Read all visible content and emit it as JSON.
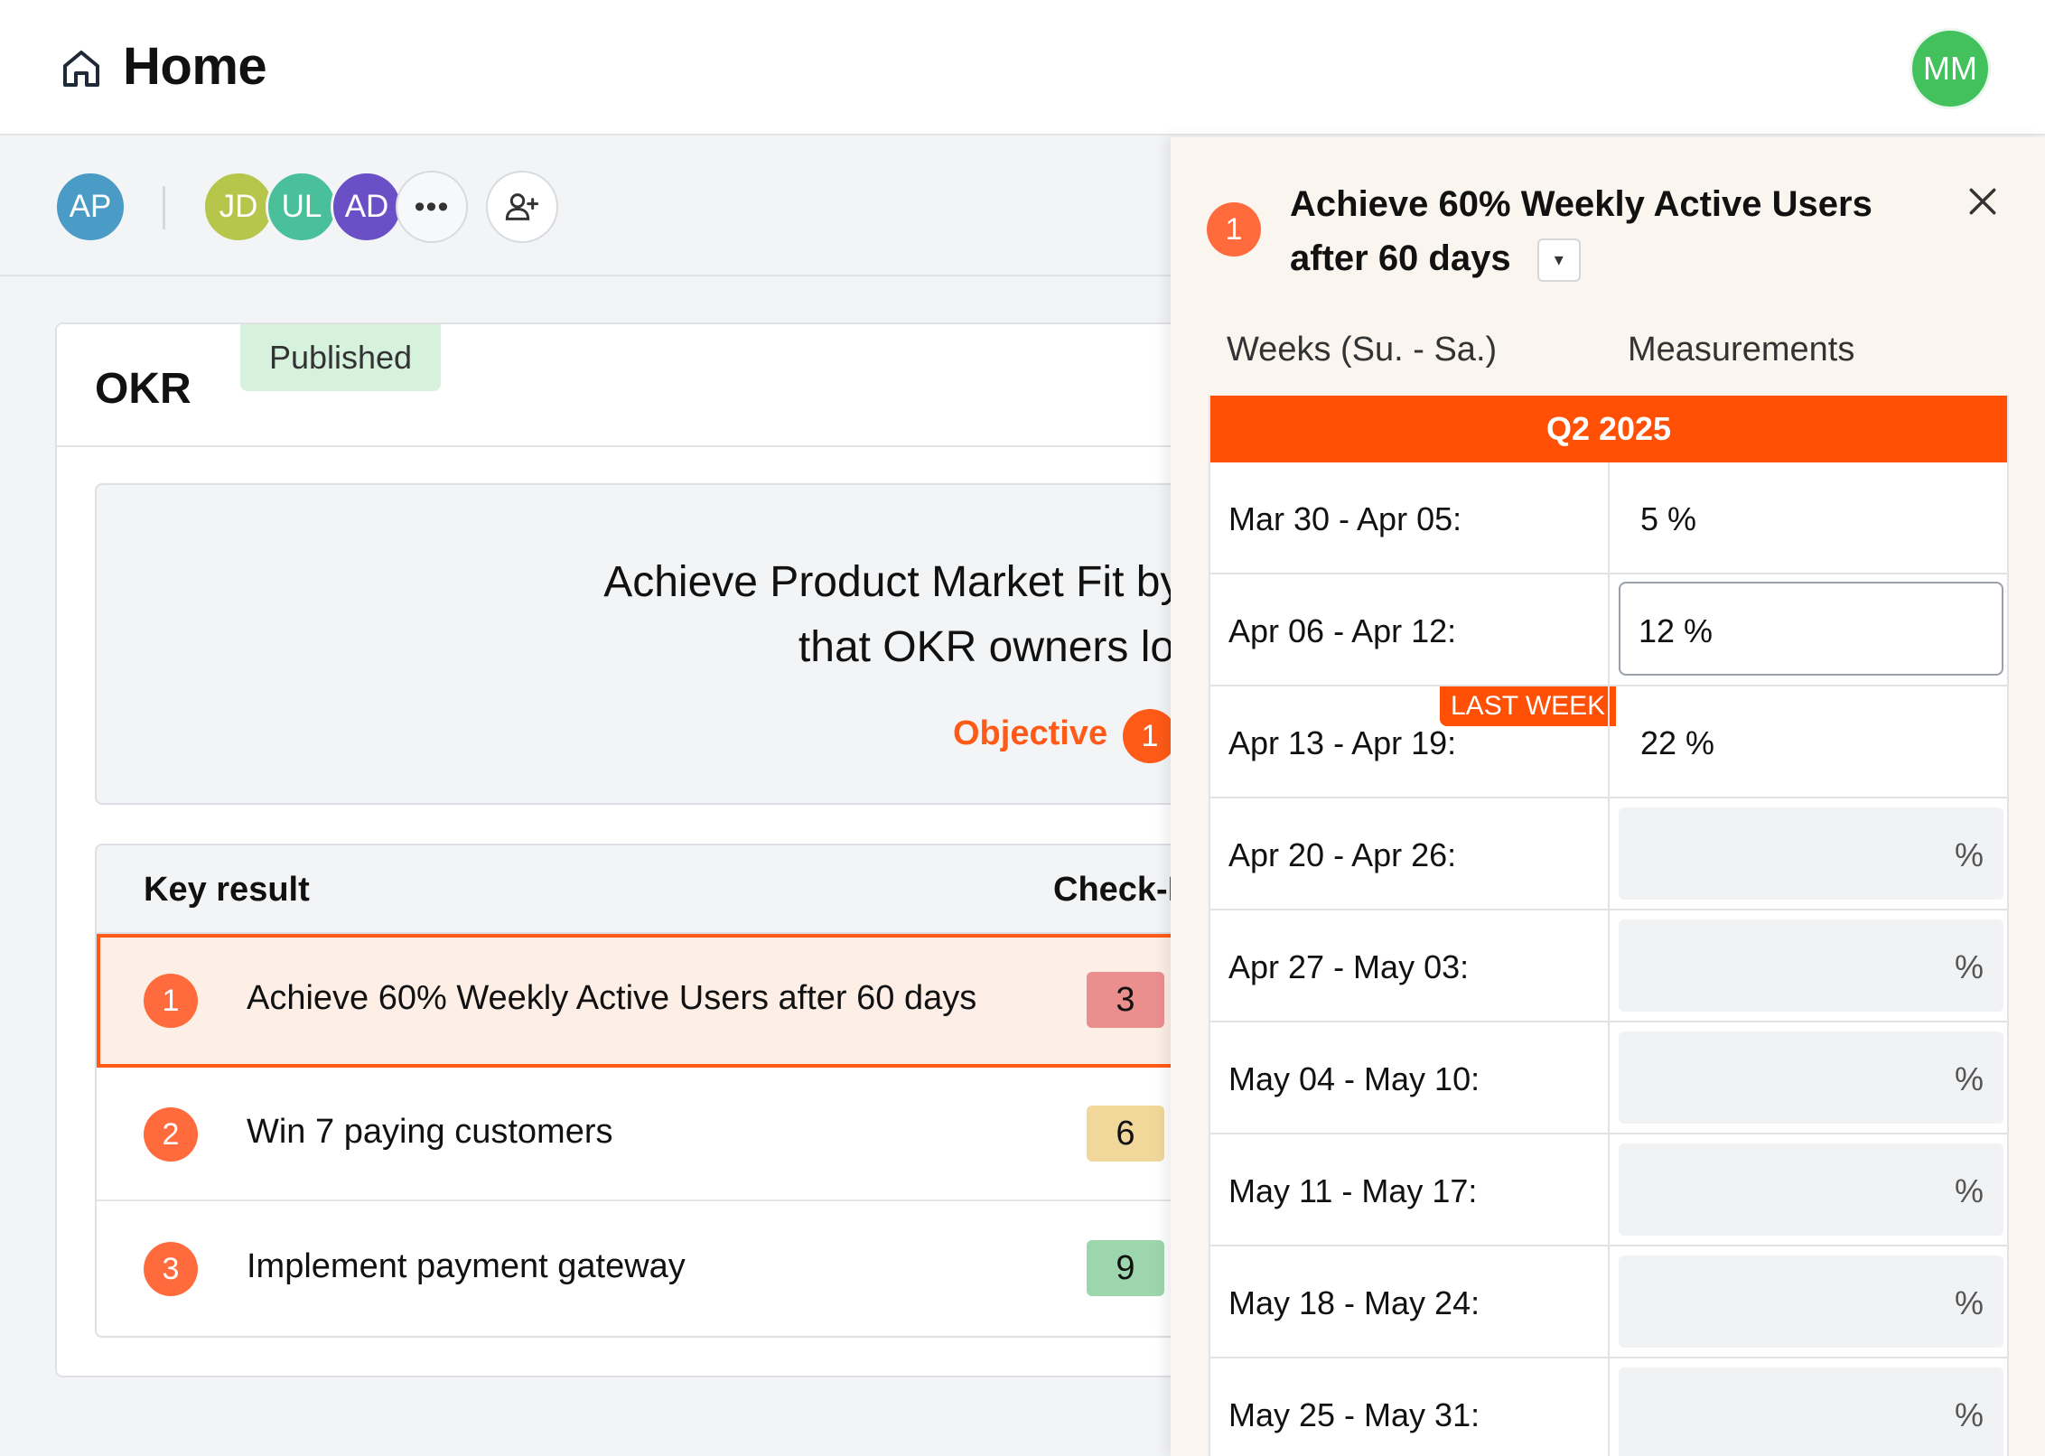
{
  "header": {
    "title": "Home",
    "user_initials": "MM"
  },
  "team": {
    "owner": {
      "initials": "AP",
      "color": "#4a9cc6"
    },
    "members": [
      {
        "initials": "JD",
        "color": "#b5c64a"
      },
      {
        "initials": "UL",
        "color": "#49bf9a"
      },
      {
        "initials": "AD",
        "color": "#6a4fc6"
      }
    ],
    "more_label": "•••"
  },
  "okr": {
    "title": "OKR",
    "status": "Published",
    "objective_text": "Achieve Product Market Fit by c\nthat OKR owners lo",
    "objective_label": "Objective",
    "objective_number": "1",
    "table_headers": {
      "key_result": "Key result",
      "check_in": "Check-I"
    },
    "key_results": [
      {
        "num": "1",
        "text": "Achieve 60% Weekly Active Users after 60 days",
        "score": "3",
        "badge_color": "#ea8e8e"
      },
      {
        "num": "2",
        "text": "Win 7 paying customers",
        "score": "6",
        "badge_color": "#f2d79a"
      },
      {
        "num": "3",
        "text": "Implement payment gateway",
        "score": "9",
        "badge_color": "#9dd6ac"
      }
    ]
  },
  "panel": {
    "num": "1",
    "title": "Achieve 60% Weekly Active Users after 60 days",
    "col_weeks": "Weeks (Su. - Sa.)",
    "col_measurements": "Measurements",
    "quarter": "Q2 2025",
    "last_week_label": "LAST WEEK",
    "weeks": [
      {
        "label": "Mar 30 - Apr 05:",
        "value": "5 %",
        "state": "filled"
      },
      {
        "label": "Apr 06 - Apr 12:",
        "value": "12 %",
        "state": "editing"
      },
      {
        "label": "Apr 13 - Apr 19:",
        "value": "22 %",
        "state": "filled"
      },
      {
        "label": "Apr 20 - Apr 26:",
        "value": "%",
        "state": "empty"
      },
      {
        "label": "Apr 27 - May 03:",
        "value": "%",
        "state": "empty"
      },
      {
        "label": "May 04 - May 10:",
        "value": "%",
        "state": "empty"
      },
      {
        "label": "May 11 - May 17:",
        "value": "%",
        "state": "empty"
      },
      {
        "label": "May 18 - May 24:",
        "value": "%",
        "state": "empty"
      },
      {
        "label": "May 25 - May 31:",
        "value": "%",
        "state": "empty"
      }
    ]
  }
}
